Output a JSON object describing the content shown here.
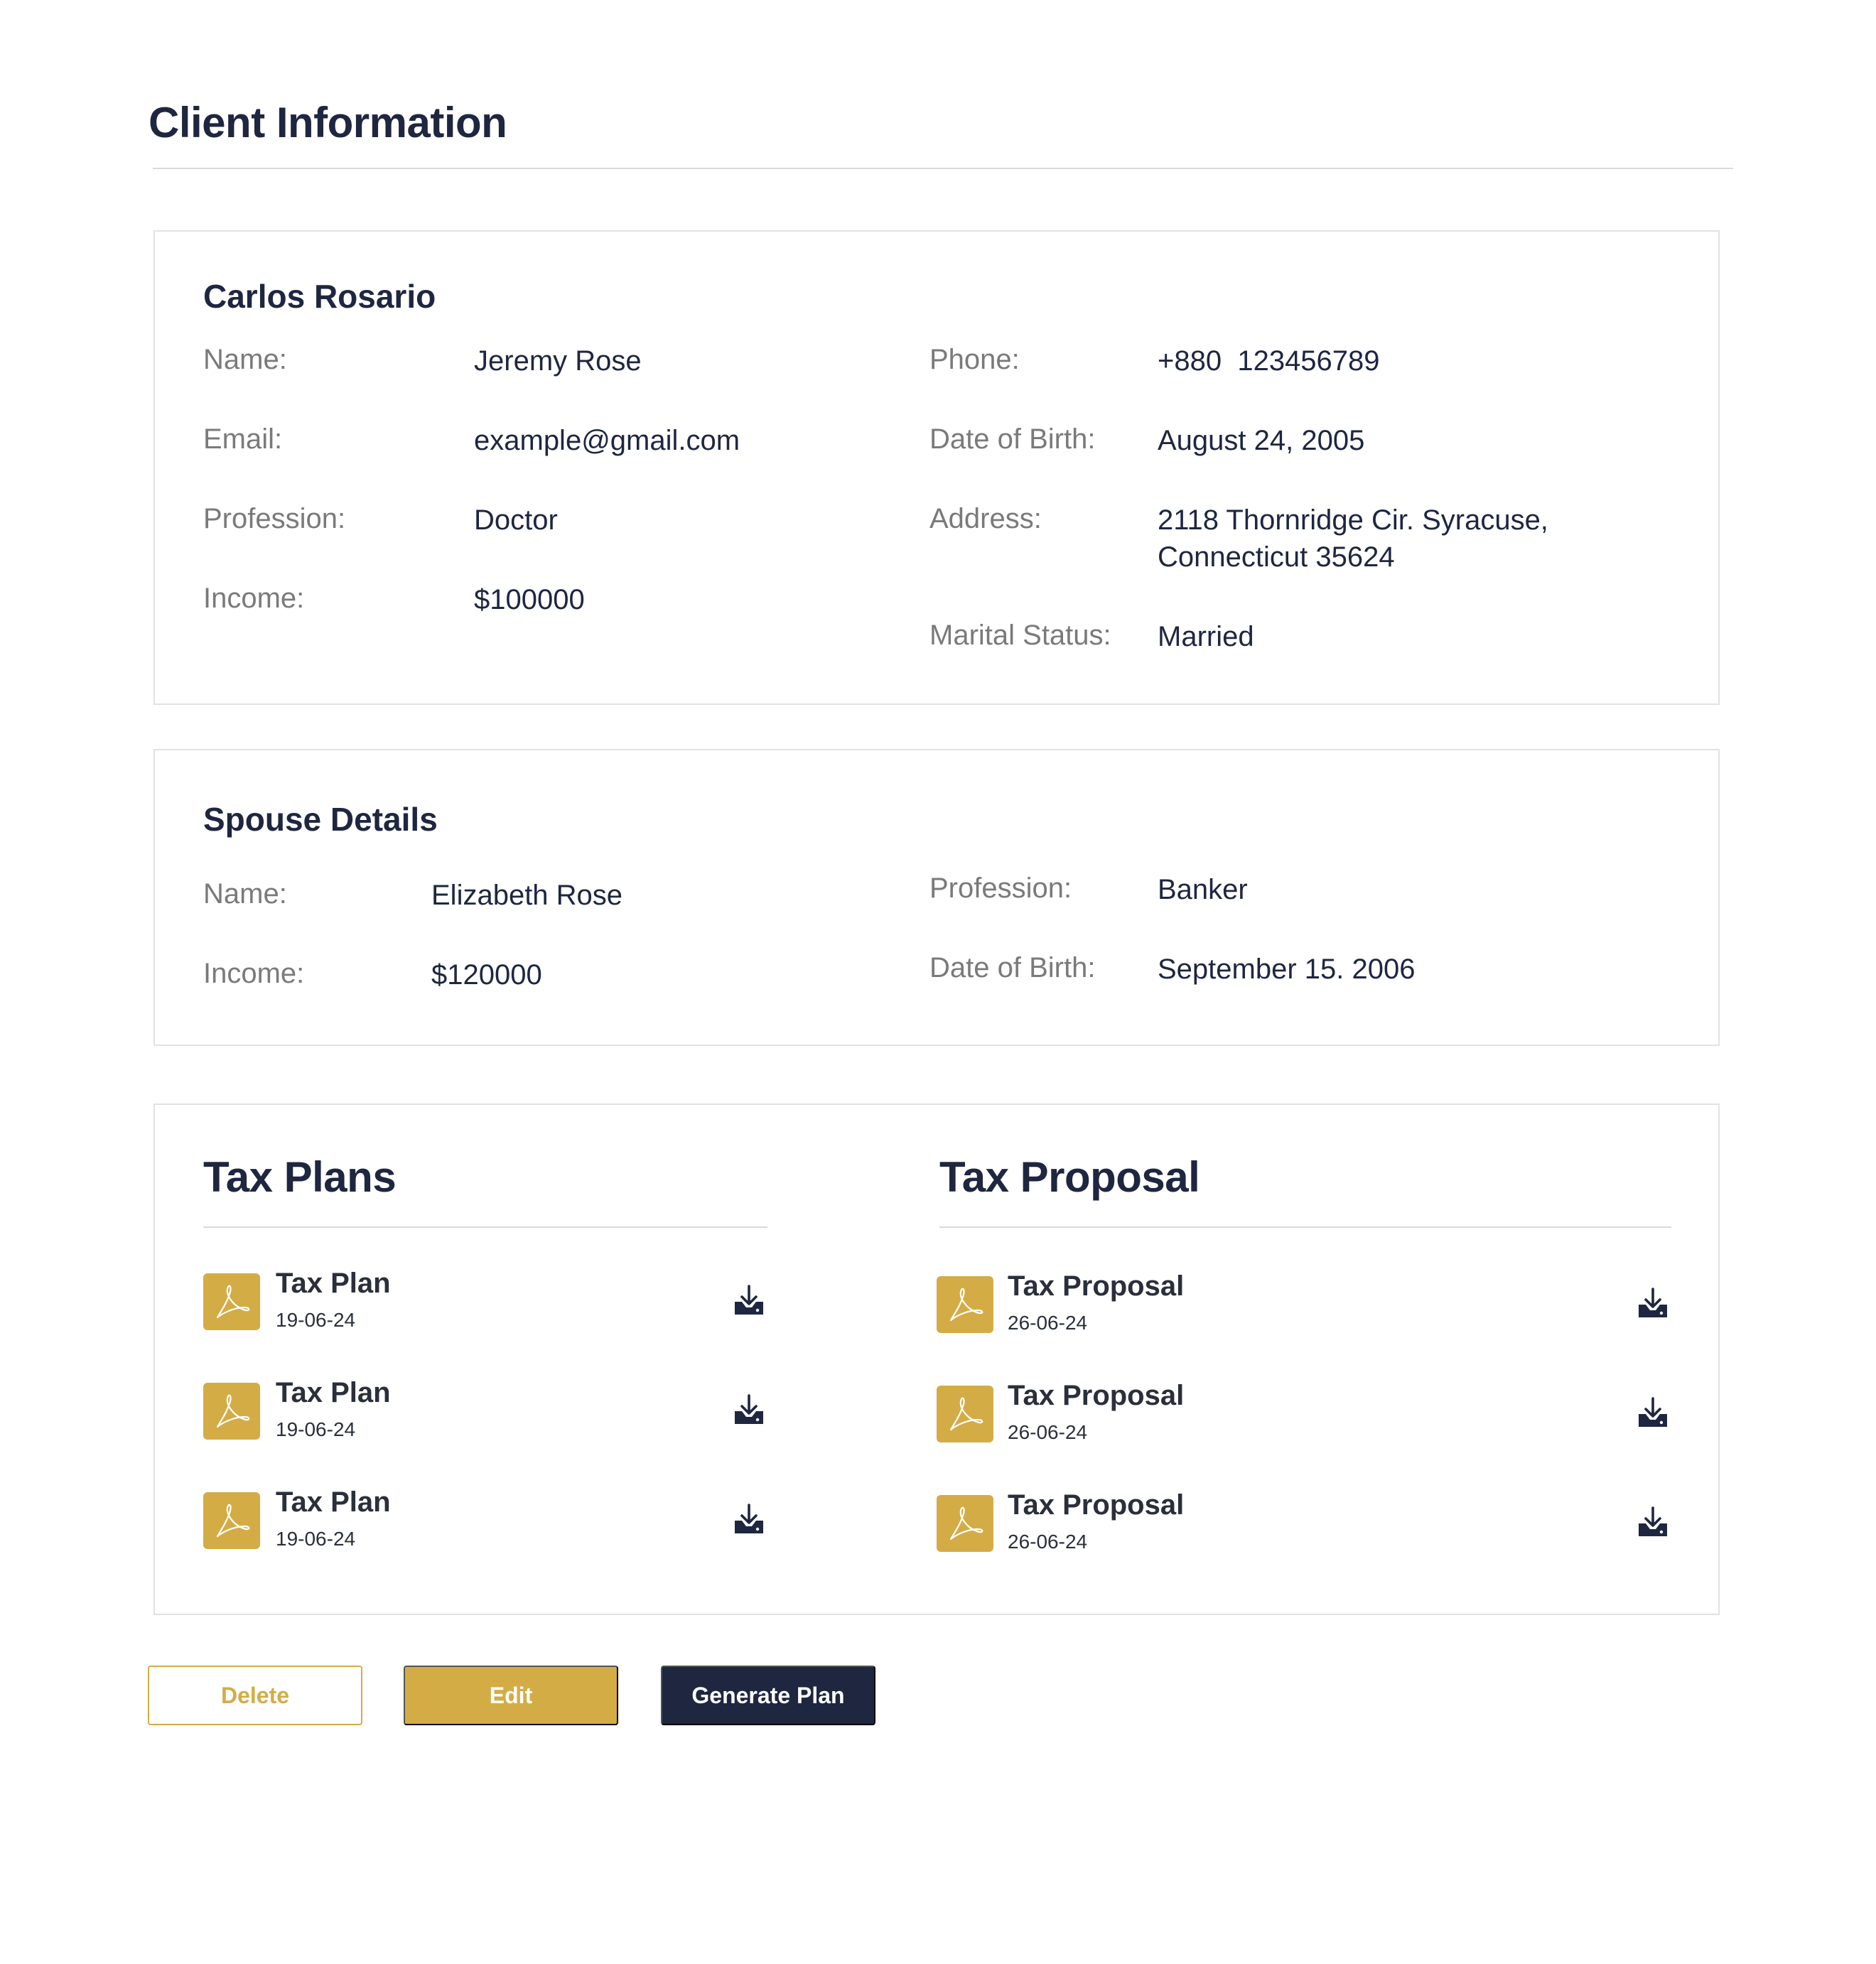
{
  "page": {
    "title": "Client Information"
  },
  "client": {
    "heading": "Carlos Rosario",
    "left_fields": [
      {
        "label": "Name:",
        "value": "Jeremy Rose"
      },
      {
        "label": "Email:",
        "value": "example@gmail.com"
      },
      {
        "label": "Profession:",
        "value": "Doctor"
      },
      {
        "label": "Income:",
        "value": "$100000"
      }
    ],
    "right_fields": [
      {
        "label": "Phone:",
        "value": "+880  123456789"
      },
      {
        "label": "Date of Birth:",
        "value": "August 24, 2005"
      },
      {
        "label": "Address:",
        "value_line1": "2118 Thornridge Cir. Syracuse,",
        "value_line2": "Connecticut 35624"
      },
      {
        "label": "Marital Status:",
        "value": "Married"
      }
    ]
  },
  "spouse": {
    "heading": "Spouse Details",
    "left_fields": [
      {
        "label": "Name:",
        "value": "Elizabeth Rose"
      },
      {
        "label": "Income:",
        "value": "$120000"
      }
    ],
    "right_fields": [
      {
        "label": "Profession:",
        "value": "Banker"
      },
      {
        "label": "Date of Birth:",
        "value": "September 15. 2006"
      }
    ]
  },
  "tax_plans": {
    "heading": "Tax Plans",
    "items": [
      {
        "name": "Tax Plan",
        "date": "19-06-24"
      },
      {
        "name": "Tax Plan",
        "date": "19-06-24"
      },
      {
        "name": "Tax Plan",
        "date": "19-06-24"
      }
    ]
  },
  "tax_proposal": {
    "heading": "Tax Proposal",
    "items": [
      {
        "name": "Tax Proposal",
        "date": "26-06-24"
      },
      {
        "name": "Tax Proposal",
        "date": "26-06-24"
      },
      {
        "name": "Tax Proposal",
        "date": "26-06-24"
      }
    ]
  },
  "actions": {
    "delete_label": "Delete",
    "edit_label": "Edit",
    "generate_label": "Generate Plan"
  },
  "colors": {
    "primary_dark": "#1e2640",
    "accent_gold": "#d4ac46",
    "label_gray": "#7a7a7a",
    "border": "#e2e2e2"
  },
  "icons": {
    "document": "pdf-icon",
    "download": "download-icon"
  }
}
